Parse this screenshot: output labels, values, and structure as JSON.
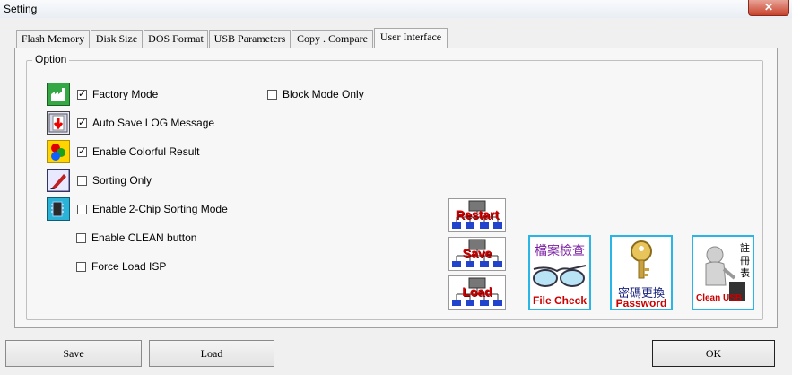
{
  "window": {
    "title": "Setting",
    "close_label": "✕"
  },
  "tabs": [
    {
      "label": "Flash Memory"
    },
    {
      "label": "Disk Size"
    },
    {
      "label": "DOS Format"
    },
    {
      "label": "USB Parameters"
    },
    {
      "label": "Copy . Compare"
    },
    {
      "label": "User Interface",
      "active": true
    }
  ],
  "option_group": {
    "label": "Option",
    "checkboxes": [
      {
        "label": "Factory Mode",
        "checked": true,
        "icon": "factory-icon"
      },
      {
        "label": "Auto Save LOG Message",
        "checked": true,
        "icon": "log-save-icon"
      },
      {
        "label": "Enable Colorful Result",
        "checked": true,
        "icon": "color-circles-icon"
      },
      {
        "label": "Sorting Only",
        "checked": false,
        "icon": "pencil-sort-icon"
      },
      {
        "label": "Enable 2-Chip Sorting Mode",
        "checked": false,
        "icon": "chip-icon"
      },
      {
        "label": "Enable CLEAN button",
        "checked": false
      },
      {
        "label": "Force Load ISP",
        "checked": false
      },
      {
        "label": "Block Mode Only",
        "checked": false
      }
    ]
  },
  "action_buttons": {
    "restart": "Restart",
    "save": "Save",
    "load": "Load",
    "file_check_cn": "檔案檢查",
    "file_check_en": "File Check",
    "password_cn": "密碼更換",
    "password_en": "Password",
    "clean_cn_1": "註",
    "clean_cn_2": "冊",
    "clean_cn_3": "表",
    "clean_en": "Clean USB"
  },
  "footer": {
    "save": "Save",
    "load": "Load",
    "ok": "OK"
  },
  "colors": {
    "accent_red": "#cc0000",
    "checkmark": "#000000",
    "tile_border": "#29b6e6"
  }
}
